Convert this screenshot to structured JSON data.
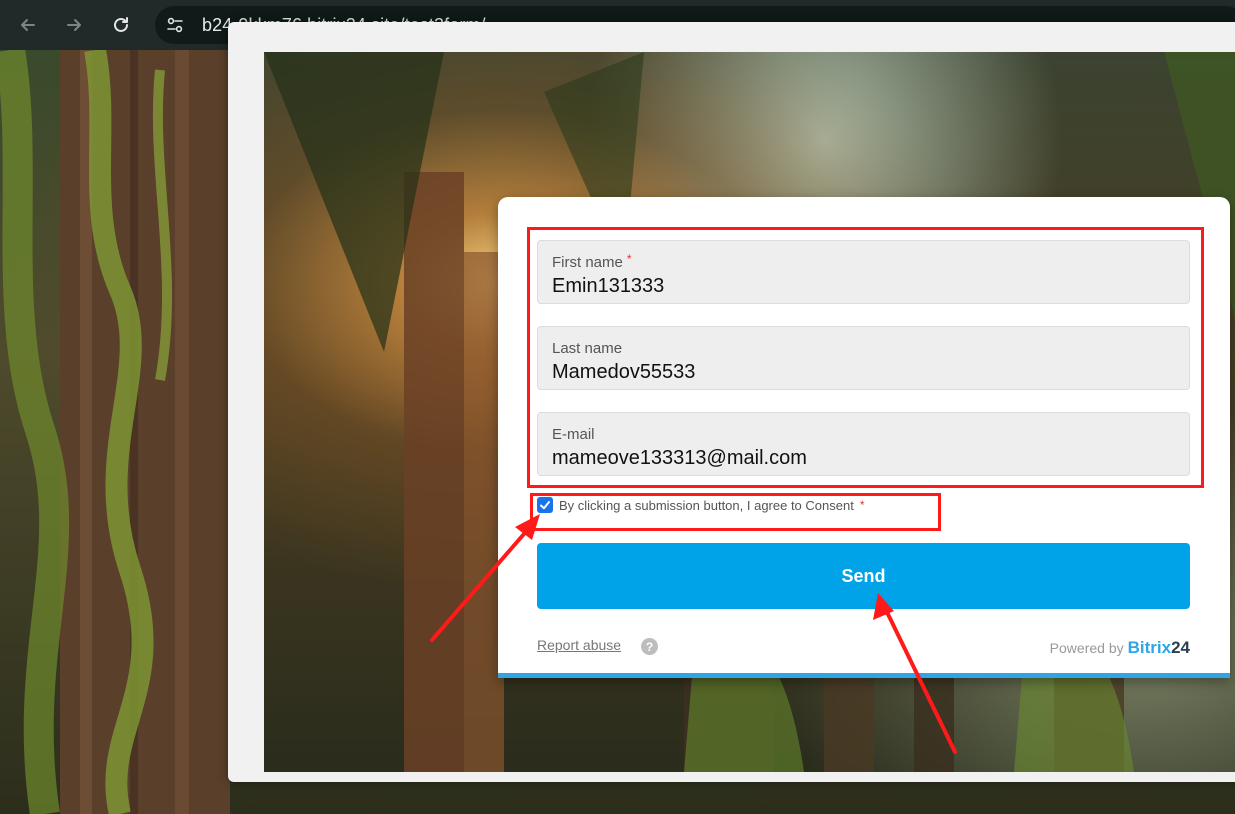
{
  "browser": {
    "url": "b24-9kkm76.bitrix24.site/test3form/",
    "icons": [
      "back-arrow-icon",
      "forward-arrow-icon",
      "reload-icon",
      "site-settings-icon"
    ]
  },
  "form": {
    "fields": [
      {
        "label": "First name",
        "required": "*",
        "value": "Emin131333"
      },
      {
        "label": "Last name",
        "value": "Mamedov55533"
      },
      {
        "label": "E-mail",
        "value": "mameove133313@mail.com"
      }
    ],
    "consent": {
      "text": "By clicking a submission button, I agree to Consent",
      "required": "*",
      "checked": true
    },
    "send_label": "Send",
    "report_label": "Report abuse",
    "help_glyph": "?",
    "powered_label": "Powered by",
    "brand_name": "Bitrix",
    "brand_suffix": "24"
  },
  "colors": {
    "send_button": "#00a2e8",
    "annotation": "#ff1a1a",
    "brand": "#2fa4e7"
  }
}
